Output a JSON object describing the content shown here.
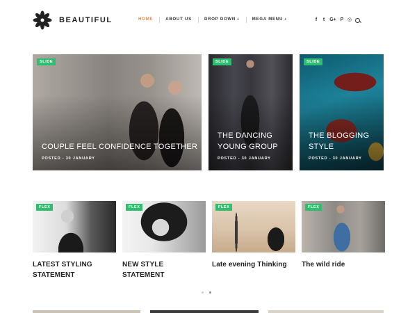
{
  "brand": {
    "name": "BEAUTIFUL"
  },
  "nav": {
    "items": [
      {
        "label": "HOME",
        "active": true,
        "dropdown": false
      },
      {
        "label": "ABOUT US",
        "active": false,
        "dropdown": false
      },
      {
        "label": "DROP DOWN",
        "active": false,
        "dropdown": true
      },
      {
        "label": "MEGA MENU",
        "active": false,
        "dropdown": true
      }
    ],
    "caret": "+"
  },
  "social": {
    "facebook": "f",
    "twitter": "t",
    "google_plus": "G+",
    "pinterest": "P",
    "instagram": "◎"
  },
  "slider": [
    {
      "badge": "SLIDE",
      "title_lines": [
        "COUPLE FEEL CONFIDENCE TOGETHER"
      ],
      "meta": "POSTED - 30 JANUARY"
    },
    {
      "badge": "SLIDE",
      "title_lines": [
        "THE DANCING",
        "YOUNG GROUP"
      ],
      "meta": "POSTED - 30 JANUARY"
    },
    {
      "badge": "SLIDE",
      "title_lines": [
        "THE BLOGGING",
        "STYLE"
      ],
      "meta": "POSTED - 30 JANUARY"
    }
  ],
  "flex_posts": [
    {
      "badge": "FLEX",
      "title": "LATEST STYLING STATEMENT"
    },
    {
      "badge": "FLEX",
      "title": "NEW STYLE STATEMENT"
    },
    {
      "badge": "FLEX",
      "title": "Late evening Thinking"
    },
    {
      "badge": "FLEX",
      "title": "The wild ride"
    }
  ],
  "colors": {
    "accent": "#e08b55",
    "badge": "#2fbe70",
    "text": "#222222"
  }
}
